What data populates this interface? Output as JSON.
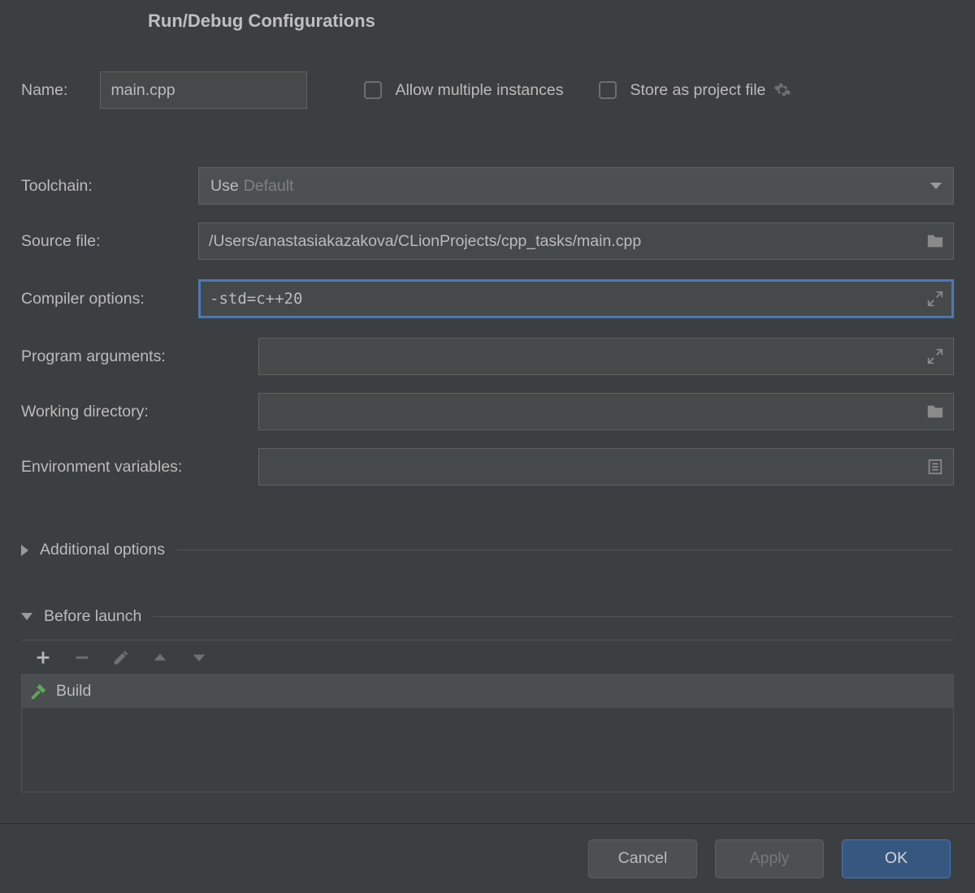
{
  "title": "Run/Debug Configurations",
  "name": {
    "label": "Name:",
    "value": "main.cpp"
  },
  "allow_multiple": {
    "label": "Allow multiple instances",
    "checked": false
  },
  "store_project": {
    "label": "Store as project file",
    "checked": false
  },
  "toolchain": {
    "label": "Toolchain:",
    "prefix": "Use",
    "value": "Default"
  },
  "source_file": {
    "label": "Source file:",
    "value": "/Users/anastasiakazakova/CLionProjects/cpp_tasks/main.cpp"
  },
  "compiler_options": {
    "label": "Compiler options:",
    "value": "-std=c++20"
  },
  "program_arguments": {
    "label": "Program arguments:",
    "value": ""
  },
  "working_directory": {
    "label": "Working directory:",
    "value": ""
  },
  "environment_variables": {
    "label": "Environment variables:",
    "value": ""
  },
  "additional_options": {
    "label": "Additional options",
    "expanded": false
  },
  "before_launch": {
    "label": "Before launch",
    "expanded": true,
    "items": [
      {
        "label": "Build",
        "icon": "hammer"
      }
    ]
  },
  "buttons": {
    "cancel": "Cancel",
    "apply": "Apply",
    "ok": "OK"
  }
}
